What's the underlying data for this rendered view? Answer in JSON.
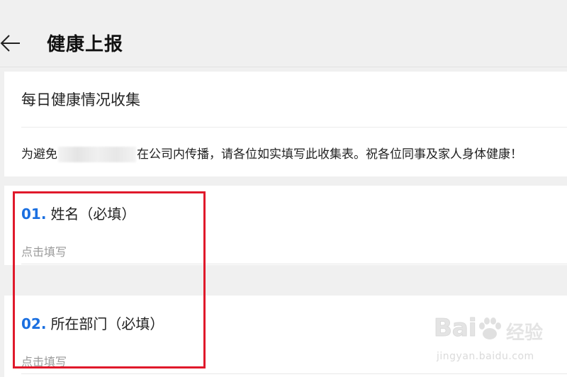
{
  "header": {
    "title": "健康上报"
  },
  "form": {
    "title": "每日健康情况收集",
    "description_before": "为避免",
    "description_after": "在公司内传播，请各位如实填写此收集表。祝各位同事及家人身体健康！"
  },
  "questions": [
    {
      "number": "01.",
      "label": "姓名（必填）",
      "placeholder": "点击填写"
    },
    {
      "number": "02.",
      "label": "所在部门（必填）",
      "placeholder": "点击填写"
    }
  ],
  "watermark": {
    "brand": "Bai",
    "name": "经验",
    "url": "jingyan.baidu.com"
  },
  "colors": {
    "accent": "#1a6fe0",
    "highlight": "#e0192b",
    "background": "#f0f0f0"
  },
  "icons": {
    "back": "arrow-left-icon",
    "watermark": "paw-icon"
  }
}
